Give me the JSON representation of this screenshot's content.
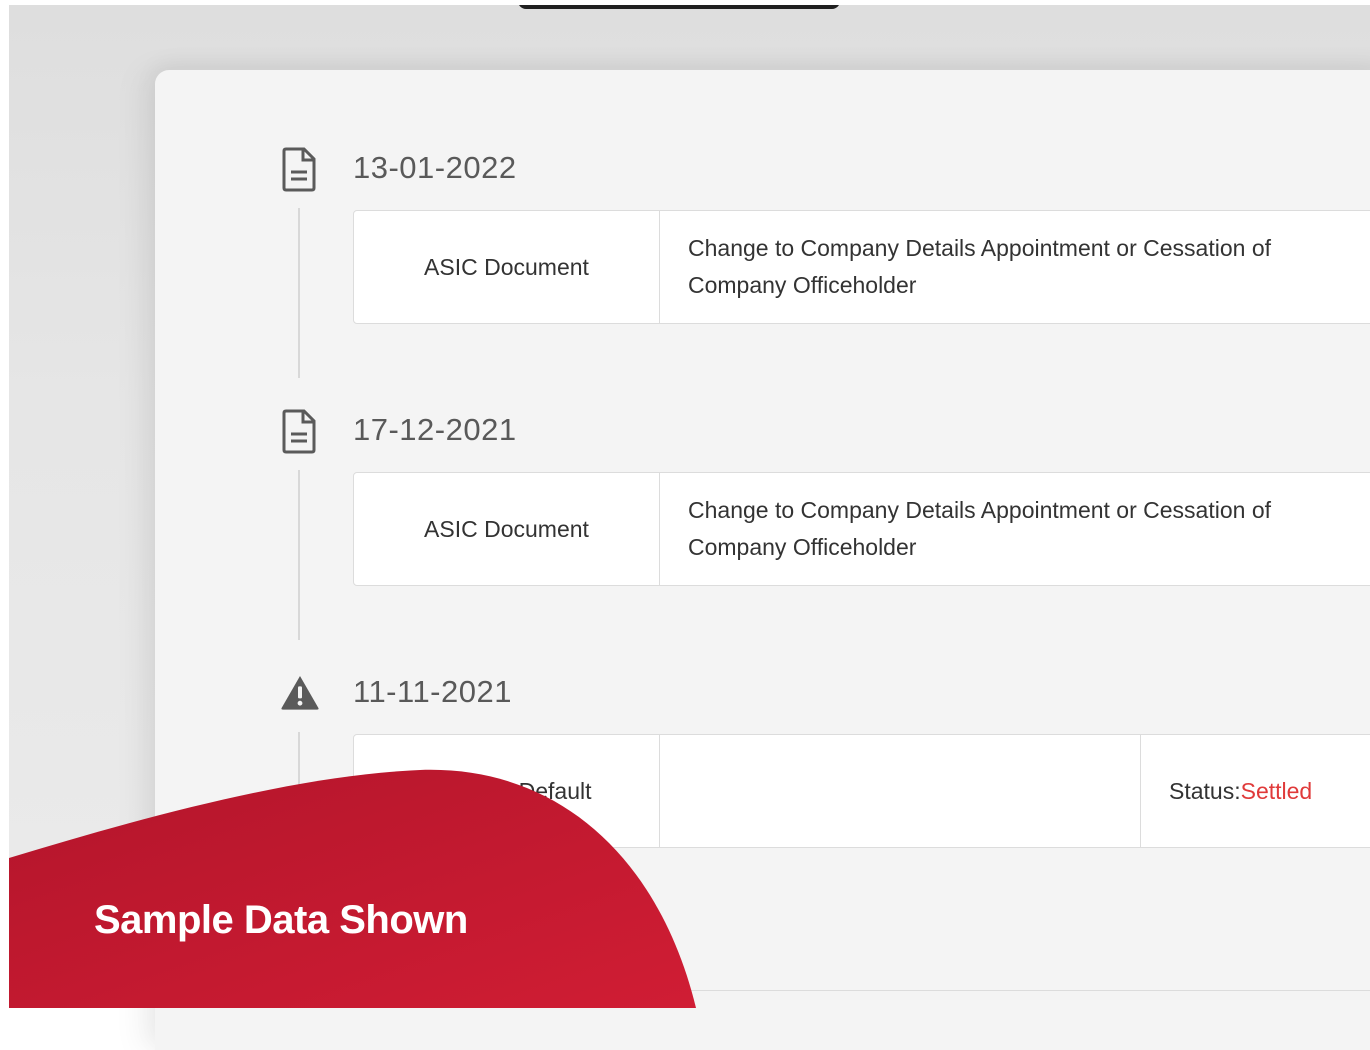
{
  "entries": [
    {
      "icon": "document-icon",
      "date": "13-01-2022",
      "type": "ASIC Document",
      "description": "Change to Company Details Appointment or Cessation of Company Officeholder"
    },
    {
      "icon": "document-icon",
      "date": "17-12-2021",
      "type": "ASIC Document",
      "description": "Change to Company Details Appointment or Cessation of Company Officeholder"
    },
    {
      "icon": "warning-icon",
      "date": "11-11-2021",
      "type": "Payment Default",
      "status_label": "Status: ",
      "status_value": "Settled"
    }
  ],
  "banner": {
    "label": "Sample Data Shown",
    "color": "#c8182f"
  },
  "colors": {
    "status_settled": "#e03a3a",
    "icon_gray": "#5a5a5a"
  }
}
